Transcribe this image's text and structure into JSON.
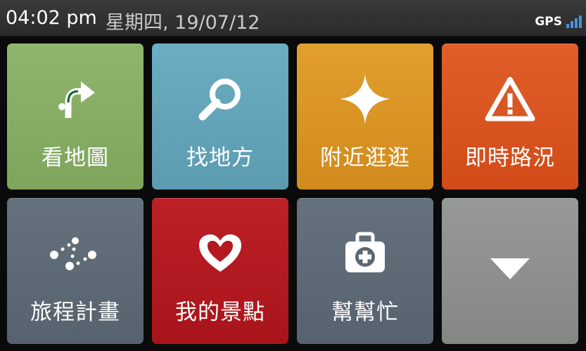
{
  "status": {
    "time": "04:02 pm",
    "date": "星期四, 19/07/12",
    "gps_label": "GPS",
    "signal_icon": "signal-bars-icon"
  },
  "tiles": [
    {
      "label": "看地圖",
      "icon": "turn-arrow-icon",
      "color": "#8ab067"
    },
    {
      "label": "找地方",
      "icon": "search-icon",
      "color": "#62a4b9"
    },
    {
      "label": "附近逛逛",
      "icon": "sparkle-icon",
      "color": "#dc9522"
    },
    {
      "label": "即時路況",
      "icon": "warning-icon",
      "color": "#db5420"
    },
    {
      "label": "旅程計畫",
      "icon": "route-plan-icon",
      "color": "#5b6873"
    },
    {
      "label": "我的景點",
      "icon": "heart-icon",
      "color": "#b3191f"
    },
    {
      "label": "幫幫忙",
      "icon": "first-aid-kit-icon",
      "color": "#5b6873"
    },
    {
      "label": "",
      "icon": "chevron-down-icon",
      "color": "#8c8e8b"
    }
  ]
}
